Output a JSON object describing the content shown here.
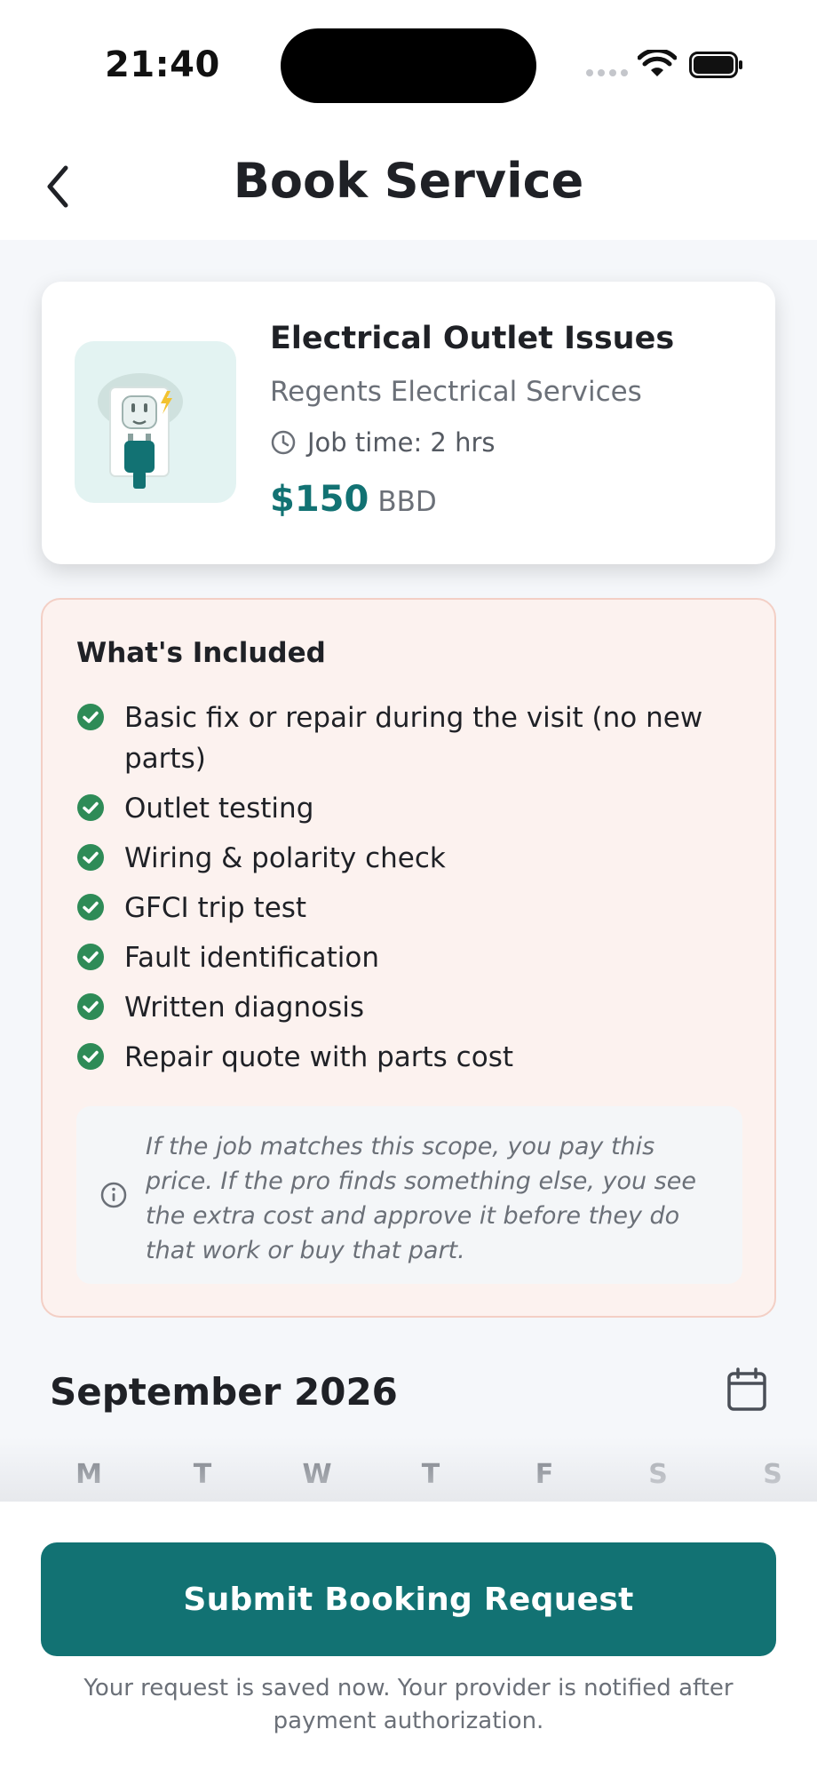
{
  "status_bar": {
    "time": "21:40"
  },
  "header": {
    "title": "Book Service"
  },
  "service": {
    "name": "Electrical Outlet Issues",
    "provider": "Regents Electrical Services",
    "job_time": "Job time: 2 hrs",
    "price": "$150",
    "currency": "BBD"
  },
  "included": {
    "title": "What's Included",
    "items": [
      "Basic fix or repair during the visit (no new parts)",
      "Outlet testing",
      "Wiring & polarity check",
      "GFCI trip test",
      "Fault identification",
      "Written diagnosis",
      "Repair quote with parts cost"
    ],
    "note": "If the job matches this scope, you pay this price. If the pro finds something else, you see the extra cost and approve it before they do that work or buy that part."
  },
  "calendar": {
    "month": "September 2026",
    "weekdays": [
      "M",
      "T",
      "W",
      "T",
      "F",
      "S",
      "S"
    ]
  },
  "footer": {
    "submit_label": "Submit Booking Request",
    "note": "Your request is saved now. Your provider is notified after payment authorization."
  },
  "colors": {
    "accent": "#127273",
    "check": "#2e8b57",
    "included_bg": "#fcf2ef",
    "included_border": "#f3cfc5"
  },
  "icons": [
    "back-chevron-icon",
    "clock-icon",
    "check-circle-icon",
    "info-icon",
    "calendar-icon",
    "wifi-icon",
    "battery-icon",
    "outlet-plug-icon"
  ]
}
